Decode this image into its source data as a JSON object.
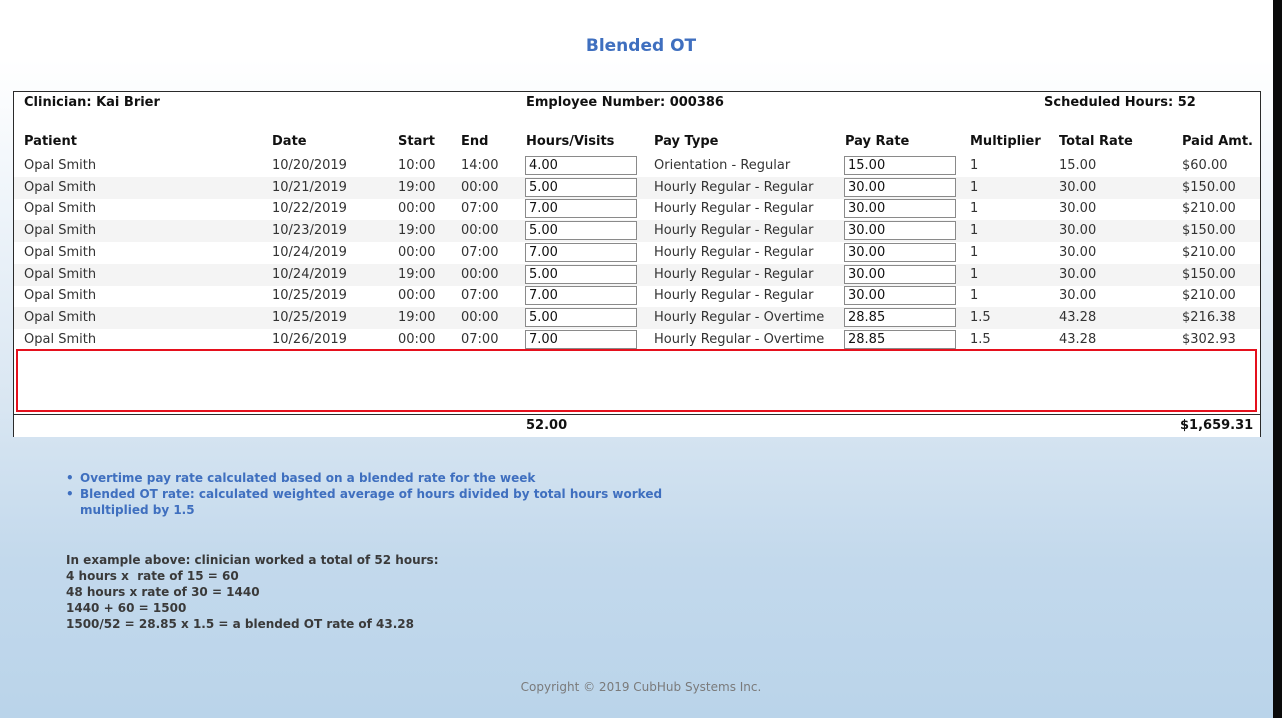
{
  "page": {
    "title": "Blended OT",
    "copyright": "Copyright © 2019 CubHub Systems Inc."
  },
  "info": {
    "clinician": "Clinician: Kai Brier",
    "employee_number": "Employee Number: 000386",
    "scheduled_hours": "Scheduled Hours: 52"
  },
  "columns": [
    "Patient",
    "Date",
    "Start",
    "End",
    "Hours/Visits",
    "Pay Type",
    "Pay Rate",
    "Multiplier",
    "Total Rate",
    "Paid Amt."
  ],
  "rows": [
    {
      "patient": "Opal Smith",
      "date": "10/20/2019",
      "start": "10:00",
      "end": "14:00",
      "hours": "4.00",
      "pay_type": "Orientation - Regular",
      "pay_rate": "15.00",
      "multiplier": "1",
      "total_rate": "15.00",
      "paid": "$60.00"
    },
    {
      "patient": "Opal Smith",
      "date": "10/21/2019",
      "start": "19:00",
      "end": "00:00",
      "hours": "5.00",
      "pay_type": "Hourly Regular - Regular",
      "pay_rate": "30.00",
      "multiplier": "1",
      "total_rate": "30.00",
      "paid": "$150.00"
    },
    {
      "patient": "Opal Smith",
      "date": "10/22/2019",
      "start": "00:00",
      "end": "07:00",
      "hours": "7.00",
      "pay_type": "Hourly Regular - Regular",
      "pay_rate": "30.00",
      "multiplier": "1",
      "total_rate": "30.00",
      "paid": "$210.00"
    },
    {
      "patient": "Opal Smith",
      "date": "10/23/2019",
      "start": "19:00",
      "end": "00:00",
      "hours": "5.00",
      "pay_type": "Hourly Regular - Regular",
      "pay_rate": "30.00",
      "multiplier": "1",
      "total_rate": "30.00",
      "paid": "$150.00"
    },
    {
      "patient": "Opal Smith",
      "date": "10/24/2019",
      "start": "00:00",
      "end": "07:00",
      "hours": "7.00",
      "pay_type": "Hourly Regular - Regular",
      "pay_rate": "30.00",
      "multiplier": "1",
      "total_rate": "30.00",
      "paid": "$210.00"
    },
    {
      "patient": "Opal Smith",
      "date": "10/24/2019",
      "start": "19:00",
      "end": "00:00",
      "hours": "5.00",
      "pay_type": "Hourly Regular - Regular",
      "pay_rate": "30.00",
      "multiplier": "1",
      "total_rate": "30.00",
      "paid": "$150.00"
    },
    {
      "patient": "Opal Smith",
      "date": "10/25/2019",
      "start": "00:00",
      "end": "07:00",
      "hours": "7.00",
      "pay_type": "Hourly Regular - Regular",
      "pay_rate": "30.00",
      "multiplier": "1",
      "total_rate": "30.00",
      "paid": "$210.00"
    },
    {
      "patient": "Opal Smith",
      "date": "10/25/2019",
      "start": "19:00",
      "end": "00:00",
      "hours": "5.00",
      "pay_type": "Hourly Regular - Overtime",
      "pay_rate": "28.85",
      "multiplier": "1.5",
      "total_rate": "43.28",
      "paid": "$216.38"
    },
    {
      "patient": "Opal Smith",
      "date": "10/26/2019",
      "start": "00:00",
      "end": "07:00",
      "hours": "7.00",
      "pay_type": "Hourly Regular - Overtime",
      "pay_rate": "28.85",
      "multiplier": "1.5",
      "total_rate": "43.28",
      "paid": "$302.93"
    }
  ],
  "totals": {
    "hours": "52.00",
    "paid": "$1,659.31"
  },
  "notes": {
    "bullet_char": "•",
    "bullets": [
      "Overtime pay rate calculated based on a blended rate for the week",
      "Blended OT rate: calculated weighted average of hours divided by total hours worked\nmultiplied by 1.5"
    ],
    "example_lines": [
      "In example above: clinician worked a total of 52 hours:",
      "4 hours x  rate of 15 = 60",
      "48 hours x rate of 30 = 1440",
      "1440 + 60 = 1500",
      "1500/52 = 28.85 x 1.5 = a blended OT rate of 43.28"
    ]
  },
  "colors": {
    "title": "#3f6fbf",
    "highlight_border": "#e5101d",
    "note_text": "#3f6fbf"
  }
}
